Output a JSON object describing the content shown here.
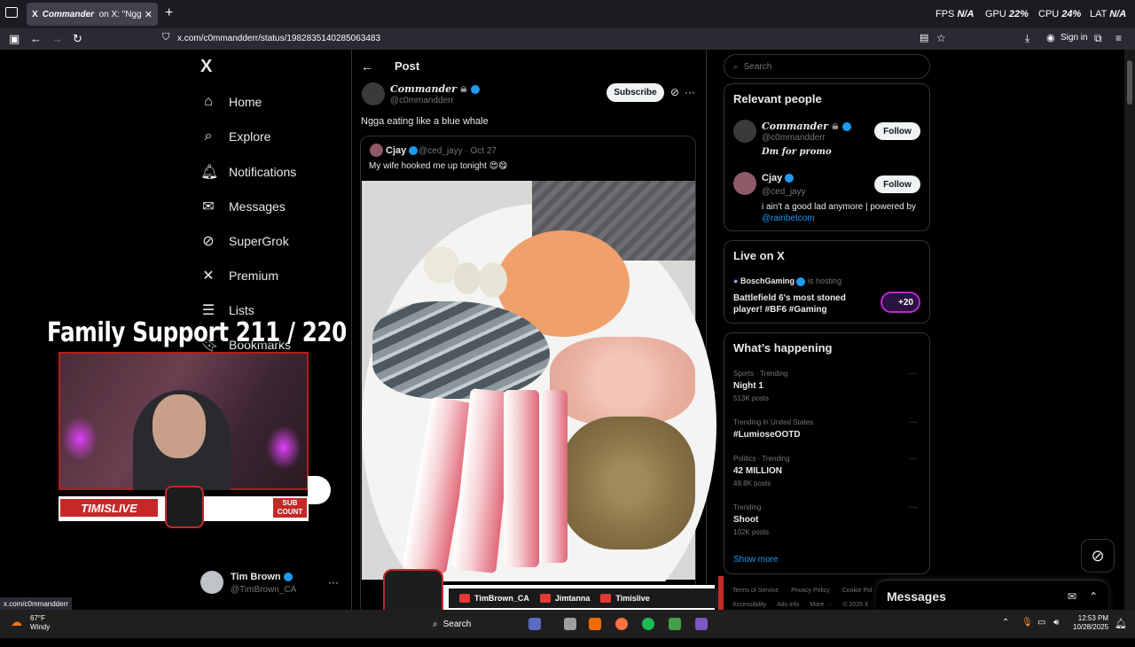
{
  "browser": {
    "tab_title": "on X: \"Ngga",
    "tab_x": "X",
    "tab_author": "Commander",
    "url": "x.com/c0mmandderr/status/1982835140285063483",
    "sign_in": "Sign in",
    "stats": {
      "fps_label": "FPS",
      "fps_value": "N/A",
      "gpu_label": "GPU",
      "gpu_value": "22%",
      "cpu_label": "CPU",
      "cpu_value": "24%",
      "lat_label": "LAT",
      "lat_value": "N/A"
    }
  },
  "nav": {
    "logo": "X",
    "items": [
      {
        "label": "Home",
        "icon": "home-icon"
      },
      {
        "label": "Explore",
        "icon": "search-icon"
      },
      {
        "label": "Notifications",
        "icon": "bell-icon"
      },
      {
        "label": "Messages",
        "icon": "mail-icon"
      },
      {
        "label": "SuperGrok",
        "icon": "grok-icon"
      },
      {
        "label": "Premium",
        "icon": "x-icon"
      },
      {
        "label": "Lists",
        "icon": "list-icon"
      },
      {
        "label": "Bookmarks",
        "icon": "bookmark-icon"
      }
    ],
    "profile": {
      "name": "Tim Brown",
      "handle": "@TimBrown_CA"
    }
  },
  "overlay": {
    "family_support": "Family Support  211 / 220",
    "banner_left": "TIMISLIVE",
    "sub_count": "SUB COUNT"
  },
  "post": {
    "header": "Post",
    "author_name": "Commander",
    "author_handle": "@c0mmandderr",
    "subscribe": "Subscribe",
    "text": "Ngga eating like a blue whale",
    "quote": {
      "name": "Cjay",
      "handle_date": "@ced_jayy · Oct 27",
      "text": "My wife hooked me up tonight 😍😋"
    }
  },
  "sidebar": {
    "search_placeholder": "Search",
    "relevant": {
      "title": "Relevant people",
      "people": [
        {
          "name": "Commander",
          "handle": "@c0mmandderr",
          "bio": "Dm for promo",
          "follow": "Follow"
        },
        {
          "name": "Cjay",
          "handle": "@ced_jayy",
          "bio": "i ain't a good lad anymore | powered by",
          "bio_link": "@rainbetcom",
          "follow": "Follow"
        }
      ]
    },
    "live": {
      "title": "Live on X",
      "host": "BoschGaming",
      "hosting": "is hosting",
      "stream_title": "Battlefield 6's most stoned player! #BF6 #Gaming",
      "viewers": "+20"
    },
    "happening": {
      "title": "What’s happening",
      "trends": [
        {
          "meta": "Sports · Trending",
          "title": "Night 1",
          "count": "513K posts"
        },
        {
          "meta": "Trending in United States",
          "title": "#LumioseOOTD",
          "count": ""
        },
        {
          "meta": "Politics · Trending",
          "title": "42 MILLION",
          "count": "49.8K posts"
        },
        {
          "meta": "Trending",
          "title": "Shoot",
          "count": "102K posts"
        }
      ],
      "show_more": "Show more"
    },
    "footer": {
      "links1": [
        "Terms of Service",
        "Privacy Policy",
        "Cookie Pol"
      ],
      "links2": [
        "Accessibility",
        "Ads info",
        "More ···",
        "© 2025 X"
      ]
    }
  },
  "messages": {
    "title": "Messages"
  },
  "stream_bar": {
    "socials": [
      "TimBrown_CA",
      "Jimtanna",
      "Timislive"
    ]
  },
  "status_url": "x.com/c0mmandderr",
  "taskbar": {
    "temp": "67°F",
    "weather": "Windy",
    "search": "Search",
    "time": "12:53 PM",
    "date": "10/28/2025"
  }
}
